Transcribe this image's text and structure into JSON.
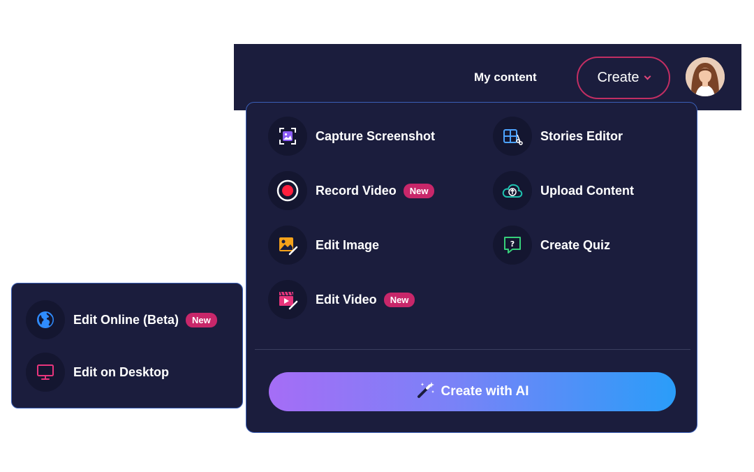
{
  "topbar": {
    "my_content_label": "My content",
    "create_label": "Create"
  },
  "menu": {
    "items": [
      {
        "label": "Capture Screenshot",
        "icon": "screenshot-icon"
      },
      {
        "label": "Stories Editor",
        "icon": "stories-editor-icon"
      },
      {
        "label": "Record Video",
        "icon": "record-icon",
        "badge": "New"
      },
      {
        "label": "Upload Content",
        "icon": "cloud-upload-icon"
      },
      {
        "label": "Edit Image",
        "icon": "edit-image-icon"
      },
      {
        "label": "Create Quiz",
        "icon": "quiz-icon"
      },
      {
        "label": "Edit Video",
        "icon": "edit-video-icon",
        "badge": "New"
      }
    ],
    "ai_button_label": "Create with AI"
  },
  "submenu": {
    "items": [
      {
        "label": "Edit Online (Beta)",
        "icon": "globe-icon",
        "badge": "New"
      },
      {
        "label": "Edit on Desktop",
        "icon": "monitor-icon"
      }
    ]
  },
  "colors": {
    "panel_bg": "#1b1d3d",
    "accent_pink": "#c8276a",
    "border_blue": "#3a5fb8"
  }
}
